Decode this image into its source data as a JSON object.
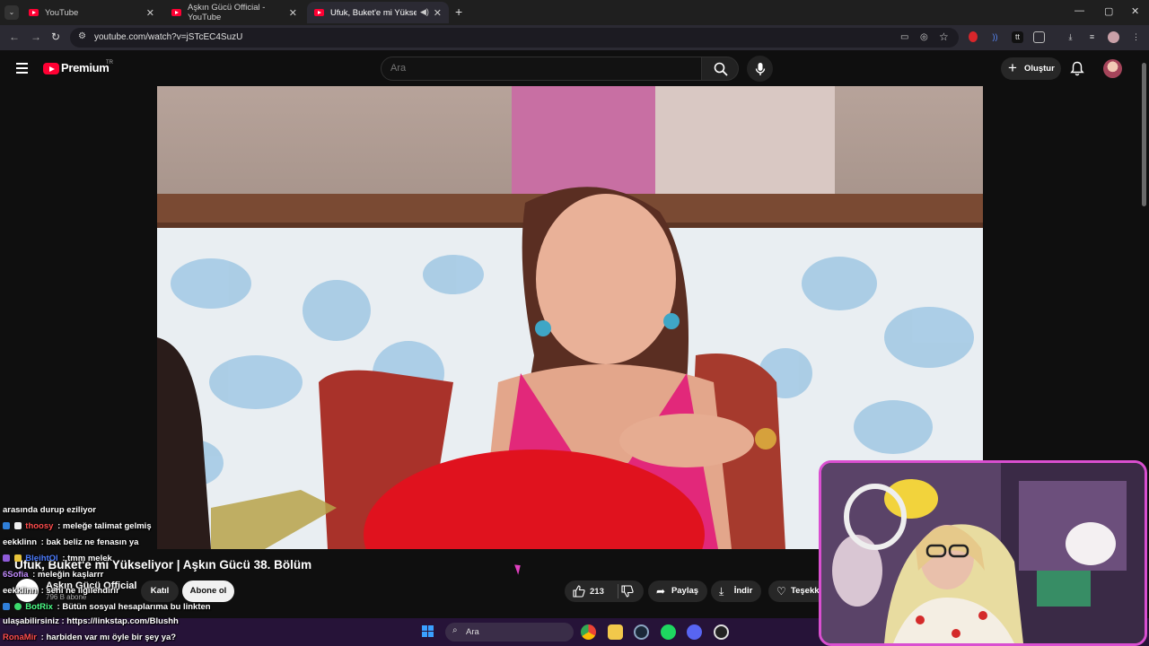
{
  "browser": {
    "tabs": [
      {
        "title": "YouTube"
      },
      {
        "title": "Aşkın Gücü Official - YouTube"
      },
      {
        "title": "Ufuk, Buket'e mi Yükseliyor"
      }
    ],
    "new_tab": "+",
    "url": "youtube.com/watch?v=jSTcEC4SuzU"
  },
  "youtube": {
    "brand": "Premium",
    "region": "TR",
    "search_placeholder": "Ara",
    "create_label": "Oluştur"
  },
  "video": {
    "title": "Ufuk, Buket'e mi Yükseliyor | Aşkın Gücü 38. Bölüm",
    "channel": "Aşkın Gücü Official",
    "subscribers": "796 B abone",
    "join_label": "Katıl",
    "subscribe_label": "Abone ol",
    "likes": "213",
    "share_label": "Paylaş",
    "download_label": "İndir",
    "thanks_label": "Teşekk"
  },
  "chat": [
    {
      "user": "",
      "user_color": "#ffffff",
      "text": "arasında durup eziliyor"
    },
    {
      "user": "thoosy",
      "user_color": "#ff4d4d",
      "text": ": meleğe talimat gelmiş"
    },
    {
      "user": "eekklinn",
      "user_color": "#ffffff",
      "text": ": bak beliz ne fenasın ya"
    },
    {
      "user": "BleihtOl",
      "user_color": "#4d7dff",
      "text": ": tmm melek"
    },
    {
      "user": "6Sofia",
      "user_color": "#c38cff",
      "text": ": meleğin kaşlarrr"
    },
    {
      "user": "eekklinn",
      "user_color": "#ffffff",
      "text": ": seni ne ilgilendirir"
    },
    {
      "user": "BotRix",
      "user_color": "#4dff88",
      "text": ": Bütün sosyal hesaplarıma bu linkten"
    },
    {
      "user": "",
      "user_color": "#ffffff",
      "text": "ulaşabilirsiniz : https://linkstap.com/Blushh"
    },
    {
      "user": "RonaMir",
      "user_color": "#ff4d4d",
      "text": ": harbiden var mı öyle bir şey ya?"
    }
  ],
  "taskbar": {
    "search_label": "Ara"
  },
  "icons": {
    "search": "search-icon",
    "mic": "mic-icon",
    "bell": "bell-icon",
    "like": "thumbs-up-icon",
    "dislike": "thumbs-down-icon",
    "share": "share-icon",
    "download": "download-icon",
    "thanks": "heart-dollar-icon"
  },
  "colors": {
    "youtube_red": "#ff0033",
    "webcam_border": "#d94fd0",
    "page_background": "#0f0f0f"
  }
}
